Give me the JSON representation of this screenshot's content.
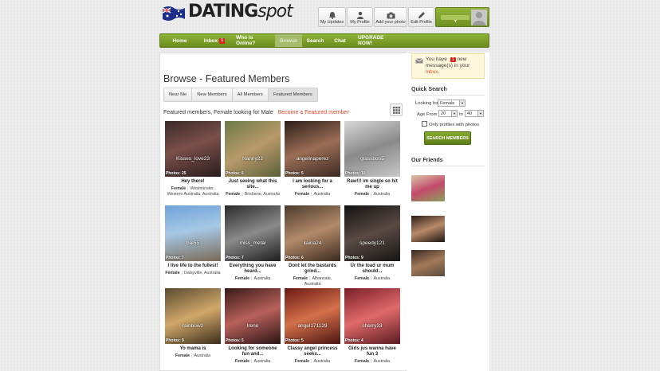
{
  "brand": {
    "logo_dating": "DATING",
    "logo_spot": "spot"
  },
  "top_buttons": [
    {
      "label": "My Updates",
      "icon": "bell-icon"
    },
    {
      "label": "My Profile",
      "icon": "person-icon"
    },
    {
      "label": "Add your photo",
      "icon": "camera-icon"
    },
    {
      "label": "Edit Profile",
      "icon": "pencil-icon"
    }
  ],
  "nav": {
    "home": "Home",
    "inbox": "Inbox",
    "inbox_count": "1",
    "whos_online": "Who is Online?",
    "browse": "Browse",
    "search": "Search",
    "chat": "Chat",
    "upgrade": "UPGRADE NOW!"
  },
  "page": {
    "title": "Browse - Featured Members",
    "tabs": [
      "Near Me",
      "New Members",
      "All Members",
      "Featured Members"
    ],
    "featured_text": "Featured members, Female looking for Male",
    "become_link": "Become a Featured member"
  },
  "members": [
    {
      "username": "Kisses_love23",
      "photos": "Photos: 25",
      "title": "Hey there!",
      "gender": "Female",
      "location": "Westminster, Western Australia, Australia"
    },
    {
      "username": "Nanny22",
      "photos": "Photos: 6",
      "title": "Just seeing what this site...",
      "gender": "Female",
      "location": "Brisbane, Australia"
    },
    {
      "username": "angelinaperez",
      "photos": "Photos: 5",
      "title": "I am looking for a serious...",
      "gender": "Female",
      "location": "Australia"
    },
    {
      "username": "glassboo5",
      "photos": "Photos: 10",
      "title": "Raw!!! im single so hit me up",
      "gender": "Female",
      "location": "Australia"
    },
    {
      "username": "bal55",
      "photos": "Photos: 7",
      "title": "I live life to the fullest!",
      "gender": "Female",
      "location": "Daisyville, Australia"
    },
    {
      "username": "miss_metal",
      "photos": "Photos: 7",
      "title": "Everything you have heard...",
      "gender": "Female",
      "location": "Australia"
    },
    {
      "username": "kaina24",
      "photos": "Photos: 6",
      "title": "Dont let the bastards grind...",
      "gender": "Female",
      "location": "Albanvale, Australia"
    },
    {
      "username": "speedy121",
      "photos": "Photos: 9",
      "title": "Ur the load ur mum should...",
      "gender": "Female",
      "location": "Australia"
    },
    {
      "username": "rainbow2",
      "photos": "Photos: 9",
      "title": "Yo mama is",
      "gender": "Female",
      "location": "Australia"
    },
    {
      "username": "Irene",
      "photos": "Photos: 5",
      "title": "Looking for someone fun and...",
      "gender": "Female",
      "location": "Australia"
    },
    {
      "username": "angel171129",
      "photos": "Photos: 5",
      "title": "Classy angel princess seeks...",
      "gender": "Female",
      "location": "Australia"
    },
    {
      "username": "cherry33",
      "photos": "Photos: 4",
      "title": "Girls jus wanna have fun 3",
      "gender": "Female",
      "location": "Australia"
    }
  ],
  "sidebar": {
    "inbox_note_prefix": "You have",
    "inbox_note_count": "1",
    "inbox_note_mid": "new message(s) in your",
    "inbox_note_link": "inbox",
    "inbox_note_end": ".",
    "quick_search_title": "Quick Search",
    "looking_for_label": "Looking for",
    "looking_for_value": "Female",
    "age_from_label": "Age From",
    "age_from_value": "20",
    "age_to_label": "to",
    "age_to_value": "40",
    "only_photos_label": "Only profiles with photos",
    "search_button": "SEARCH MEMBERS",
    "friends_title": "Our Friends"
  },
  "colors": {
    "nav_green": "#7a9e27",
    "accent_orange": "#d9472b",
    "badge_red": "#d9231d"
  }
}
